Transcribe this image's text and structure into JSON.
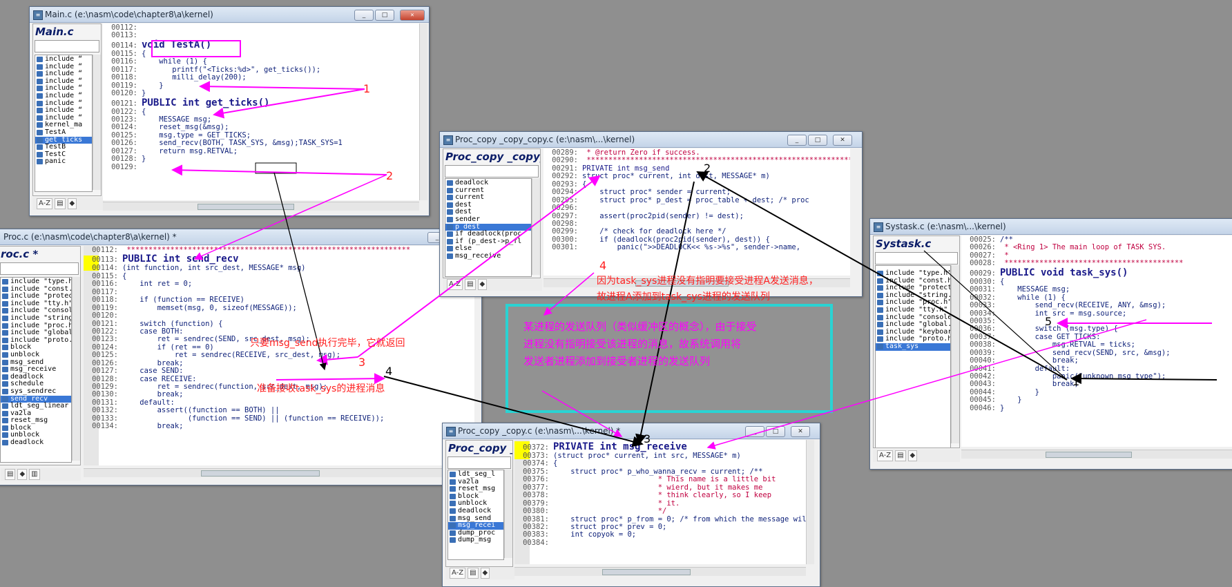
{
  "windows": {
    "main": {
      "title": "Main.c (e:\\nasm\\code\\chapter8\\a\\kernel)",
      "panel_title": "Main.c",
      "symbols": [
        "include “",
        "include “",
        "include “",
        "include “",
        "include “",
        "include “",
        "include “",
        "include “",
        "include “",
        "kernel_ma",
        "TestA",
        "get_ticks",
        "TestB",
        "TestC",
        "panic"
      ],
      "selected": 11,
      "lines": [
        {
          "n": "00112:",
          "t": ""
        },
        {
          "n": "00113:",
          "t": ""
        },
        {
          "n": "00114:",
          "t": "void TestA()",
          "big": true
        },
        {
          "n": "00115:",
          "t": "{"
        },
        {
          "n": "00116:",
          "t": "    while (1) {"
        },
        {
          "n": "00117:",
          "t": "       printf(\"<Ticks:%d>\", get_ticks());"
        },
        {
          "n": "00118:",
          "t": "       milli_delay(200);"
        },
        {
          "n": "00119:",
          "t": "    }"
        },
        {
          "n": "00120:",
          "t": "}"
        },
        {
          "n": "00121:",
          "t": "PUBLIC int get_ticks()",
          "big": true
        },
        {
          "n": "00122:",
          "t": "{"
        },
        {
          "n": "00123:",
          "t": "    MESSAGE msg;"
        },
        {
          "n": "00124:",
          "t": "    reset_msg(&msg);"
        },
        {
          "n": "00125:",
          "t": "    msg.type = GET_TICKS;"
        },
        {
          "n": "00126:",
          "t": "    send_recv(BOTH, TASK_SYS, &msg);TASK_SYS=1"
        },
        {
          "n": "00127:",
          "t": "    return msg.RETVAL;"
        },
        {
          "n": "00128:",
          "t": "}"
        },
        {
          "n": "00129:",
          "t": ""
        }
      ]
    },
    "proc": {
      "title": "Proc.c (e:\\nasm\\code\\chapter8\\a\\kernel) *",
      "panel_title": "roc.c *",
      "symbols": [
        "include \"type.h\"",
        "include \"const.h\"",
        "include \"protect.",
        "include \"tty.h\"",
        "include \"console.",
        "include \"string.h",
        "include \"proc.h\"",
        "include \"global.h",
        "include \"proto.h\"",
        "block",
        "unblock",
        "msg_send",
        "msg_receive",
        "deadlock",
        "schedule",
        "sys_sendrec",
        "send_recv",
        "ldt_seg_linear",
        "va2la",
        "reset_msg",
        "block",
        "unblock",
        "deadlock"
      ],
      "selected": 16,
      "lines": [
        {
          "n": "00112:",
          "t": " *****************************************************************"
        },
        {
          "n": "00113:",
          "t": "PUBLIC int send_recv",
          "big": true
        },
        {
          "n": "00114:",
          "t": "(int function, int src_dest, MESSAGE* msg)"
        },
        {
          "n": "00115:",
          "t": "{"
        },
        {
          "n": "00116:",
          "t": "    int ret = 0;"
        },
        {
          "n": "00117:",
          "t": ""
        },
        {
          "n": "00118:",
          "t": "    if (function == RECEIVE)"
        },
        {
          "n": "00119:",
          "t": "        memset(msg, 0, sizeof(MESSAGE));"
        },
        {
          "n": "00120:",
          "t": ""
        },
        {
          "n": "00121:",
          "t": "    switch (function) {"
        },
        {
          "n": "00122:",
          "t": "    case BOTH:"
        },
        {
          "n": "00123:",
          "t": "        ret = sendrec(SEND, src_dest, msg);"
        },
        {
          "n": "00124:",
          "t": "        if (ret == 0)"
        },
        {
          "n": "00125:",
          "t": "            ret = sendrec(RECEIVE, src_dest, msg);"
        },
        {
          "n": "00126:",
          "t": "        break;"
        },
        {
          "n": "00127:",
          "t": "    case SEND:"
        },
        {
          "n": "00128:",
          "t": "    case RECEIVE:"
        },
        {
          "n": "00129:",
          "t": "        ret = sendrec(function, src_dest, msg);"
        },
        {
          "n": "00130:",
          "t": "        break;"
        },
        {
          "n": "00131:",
          "t": "    default:"
        },
        {
          "n": "00132:",
          "t": "        assert((function == BOTH) ||"
        },
        {
          "n": "00133:",
          "t": "               (function == SEND) || (function == RECEIVE));"
        },
        {
          "n": "00134:",
          "t": "        break;"
        }
      ]
    },
    "copy1": {
      "title": "Proc_copy _copy_copy.c (e:\\nasm\\...\\kernel)",
      "panel_title": "Proc_copy _copy_c",
      "symbols": [
        "deadlock",
        "current",
        "current",
        "dest",
        "dest",
        "sender",
        "p_dest",
        "if deadlock(proc",
        "if (p_dest->p_fl",
        "else",
        "msg_receive"
      ],
      "selected": 6,
      "lines": [
        {
          "n": "00289:",
          "t": " * @return Zero if success."
        },
        {
          "n": "00290:",
          "t": " *****************************************************************"
        },
        {
          "n": "00291:",
          "t": "PRIVATE int msg_send"
        },
        {
          "n": "00292:",
          "t": "struct proc* current, int dest, MESSAGE* m)"
        },
        {
          "n": "00293:",
          "t": "{"
        },
        {
          "n": "00294:",
          "t": "    struct proc* sender = current;"
        },
        {
          "n": "00295:",
          "t": "    struct proc* p_dest = proc_table + dest; /* proc"
        },
        {
          "n": "00296:",
          "t": ""
        },
        {
          "n": "00297:",
          "t": "    assert(proc2pid(sender) != dest);"
        },
        {
          "n": "00298:",
          "t": ""
        },
        {
          "n": "00299:",
          "t": "    /* check for deadlock here */"
        },
        {
          "n": "00300:",
          "t": "    if (deadlock(proc2pid(sender), dest)) {"
        },
        {
          "n": "00301:",
          "t": "        panic(\">>DEADLOCK<< %s->%s\", sender->name,"
        }
      ]
    },
    "copy2": {
      "title": "Proc_copy _copy.c (e:\\nasm\\...\\kernel) *",
      "panel_title": "Proc_copy _",
      "symbols": [
        "ldt_seg_l",
        "va2la",
        "reset_msg",
        "block",
        "unblock",
        "deadlock",
        "msg_send",
        "msg_recei",
        "dump_proc",
        "dump_msg"
      ],
      "selected": 7,
      "lines": [
        {
          "n": "00372:",
          "t": "PRIVATE int msg_receive",
          "big": true
        },
        {
          "n": "00373:",
          "t": "(struct proc* current, int src, MESSAGE* m)"
        },
        {
          "n": "00374:",
          "t": "{"
        },
        {
          "n": "00375:",
          "t": "    struct proc* p_who_wanna_recv = current; /**"
        },
        {
          "n": "00376:",
          "t": "                        * This name is a little bit"
        },
        {
          "n": "00377:",
          "t": "                        * wierd, but it makes me"
        },
        {
          "n": "00378:",
          "t": "                        * think clearly, so I keep"
        },
        {
          "n": "00379:",
          "t": "                        * it."
        },
        {
          "n": "00380:",
          "t": "                        */"
        },
        {
          "n": "00381:",
          "t": "    struct proc* p_from = 0; /* from which the message wil"
        },
        {
          "n": "00382:",
          "t": "    struct proc* prev = 0;"
        },
        {
          "n": "00383:",
          "t": "    int copyok = 0;"
        },
        {
          "n": "00384:",
          "t": ""
        }
      ]
    },
    "systask": {
      "title": "Systask.c (e:\\nasm\\...\\kernel)",
      "panel_title": "Systask.c",
      "symbols": [
        "include \"type.h\"",
        "include \"const.h'",
        "include \"protect.",
        "include \"string.h",
        "include \"proc.h\"",
        "include \"tty.h\"",
        "include \"console.",
        "include \"global.h",
        "include \"keyboard",
        "include \"proto.h\"",
        "task_sys"
      ],
      "selected": 10,
      "lines": [
        {
          "n": "00025:",
          "t": "/**"
        },
        {
          "n": "00026:",
          "t": " * <Ring 1> The main loop of TASK SYS."
        },
        {
          "n": "00027:",
          "t": " *"
        },
        {
          "n": "00028:",
          "t": " *****************************************"
        },
        {
          "n": "00029:",
          "t": "PUBLIC void task_sys()",
          "big": true
        },
        {
          "n": "00030:",
          "t": "{"
        },
        {
          "n": "00031:",
          "t": "    MESSAGE msg;"
        },
        {
          "n": "00032:",
          "t": "    while (1) {"
        },
        {
          "n": "00033:",
          "t": "        send_recv(RECEIVE, ANY, &msg);"
        },
        {
          "n": "00034:",
          "t": "        int src = msg.source;"
        },
        {
          "n": "00035:",
          "t": ""
        },
        {
          "n": "00036:",
          "t": "        switch (msg.type) {"
        },
        {
          "n": "00037:",
          "t": "        case GET_TICKS:"
        },
        {
          "n": "00038:",
          "t": "            msg.RETVAL = ticks;"
        },
        {
          "n": "00039:",
          "t": "            send_recv(SEND, src, &msg);"
        },
        {
          "n": "00040:",
          "t": "            break;"
        },
        {
          "n": "00041:",
          "t": "        default:"
        },
        {
          "n": "00042:",
          "t": "            panic(\"unknown msg type\");"
        },
        {
          "n": "00043:",
          "t": "            break;"
        },
        {
          "n": "00044:",
          "t": "        }"
        },
        {
          "n": "00045:",
          "t": "    }"
        },
        {
          "n": "00046:",
          "t": "}"
        }
      ]
    }
  },
  "annotations": {
    "a_return": "只要msg_send执行完毕，它就返回",
    "a_ready": "准备接收task_sys的进程消息",
    "a_because_1": "因为task_sys进程没有指明要接受进程A发送消息，",
    "a_because_2": "故进程A添加到task_sys进程的发送队列",
    "a_box_1": "某进程的发送队列（类似缓冲区的概念），由于接受",
    "a_box_2": "进程没有指明接受该进程的消息，故系统调用将",
    "a_box_3": "发送者进程添加到接受者进程的发送队列",
    "n1": "1",
    "n2": "2",
    "n3": "3",
    "n4": "4",
    "n5": "5"
  },
  "toolbar": {
    "sort": "A-Z"
  },
  "colors": {
    "magenta": "#ff00ff",
    "cyan": "#2ad3d3",
    "annotation_red": "#ff2020",
    "keyword": "#c00040"
  }
}
